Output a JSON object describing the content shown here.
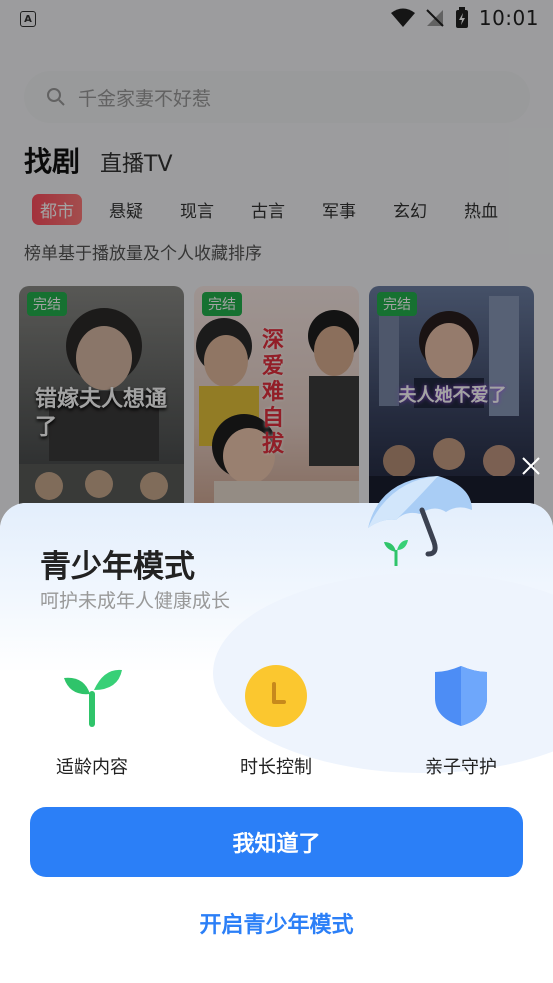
{
  "status_bar": {
    "time": "10:01",
    "app_icon_letter": "A"
  },
  "search": {
    "placeholder": "千金家妻不好惹"
  },
  "tabs": [
    {
      "label": "找剧",
      "active": true
    },
    {
      "label": "直播TV",
      "active": false
    }
  ],
  "categories": [
    "都市",
    "悬疑",
    "现言",
    "古言",
    "军事",
    "玄幻",
    "热血"
  ],
  "rank_note": "榜单基于播放量及个人收藏排序",
  "cards": [
    {
      "badge": "完结",
      "title": "错嫁夫人想通了"
    },
    {
      "badge": "完结",
      "title": "深爱难自拔"
    },
    {
      "badge": "完结",
      "title": "夫人她不爱了"
    }
  ],
  "modal": {
    "title": "青少年模式",
    "subtitle": "呵护未成年人健康成长",
    "features": [
      {
        "label": "适龄内容",
        "icon": "sprout-icon"
      },
      {
        "label": "时长控制",
        "icon": "clock-icon"
      },
      {
        "label": "亲子守护",
        "icon": "shield-icon"
      }
    ],
    "primary_button": "我知道了",
    "secondary_link": "开启青少年模式"
  },
  "colors": {
    "accent": "#2b7ff7",
    "category_active": "#ff4d5e",
    "badge": "#23b14d"
  }
}
